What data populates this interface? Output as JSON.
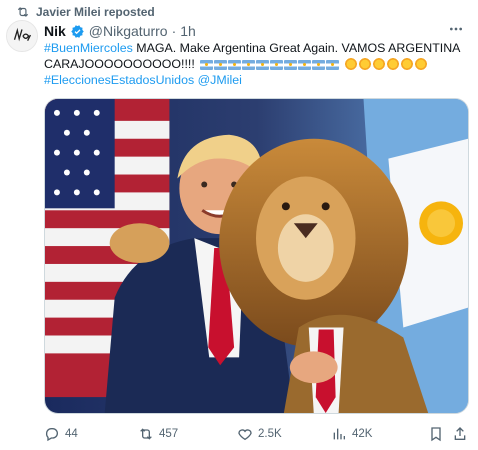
{
  "repost": {
    "label": "Javier Milei reposted",
    "icon": "repost-icon"
  },
  "author": {
    "name": "Nik",
    "handle": "@Nikgaturro",
    "separator": "·",
    "time": "1h",
    "verified": true
  },
  "tweet": {
    "line1_tag": "#BuenMiercoles",
    "line1_text": " MAGA. Make Argentina Great Again. VAMOS ARGENTINA",
    "line2_text": "CARAJOOOOOOOOOO!!!!",
    "line3_tags": "#EleccionesEstadosUnidos @JMilei",
    "emoji": {
      "argentina_flags": 10,
      "suns": 6
    }
  },
  "media": {
    "alt": "Trump embracing a lion in front of US and Argentine flags"
  },
  "actions": {
    "reply": "44",
    "repost": "457",
    "like": "2.5K",
    "views": "42K"
  },
  "colors": {
    "link": "#1d9bf0",
    "muted": "#536471",
    "text": "#0f1419"
  }
}
